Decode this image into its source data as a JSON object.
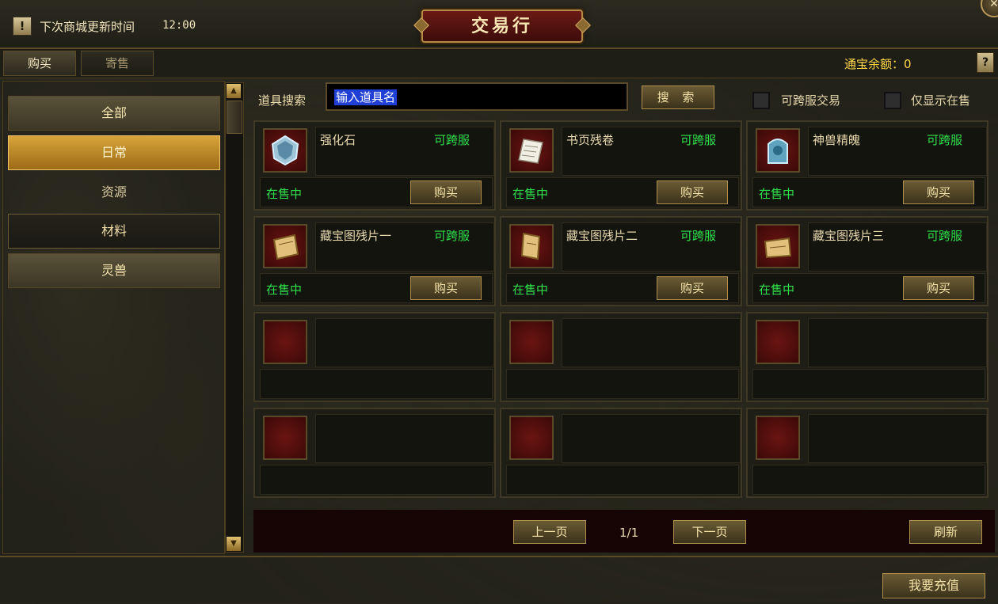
{
  "header": {
    "notice_icon": "!",
    "notice_label": "下次商城更新时间",
    "notice_time": "12:00",
    "title": "交易行",
    "close_icon": "✕"
  },
  "tabs": [
    {
      "label": "购买",
      "active": true
    },
    {
      "label": "寄售",
      "active": false
    }
  ],
  "balance": "通宝余额：0",
  "help_icon": "?",
  "categories": [
    {
      "label": "全部",
      "state": "normal"
    },
    {
      "label": "日常",
      "state": "selected"
    },
    {
      "label": "资源",
      "state": "flat"
    },
    {
      "label": "材料",
      "state": "dark"
    },
    {
      "label": "灵兽",
      "state": "normal"
    }
  ],
  "search": {
    "label": "道具搜索",
    "placeholder": "输入道具名",
    "button": "搜 索"
  },
  "filters": [
    {
      "label": "可跨服交易",
      "checked": false
    },
    {
      "label": "仅显示在售",
      "checked": false
    }
  ],
  "items": [
    {
      "name": "强化石",
      "tag": "可跨服",
      "status": "在售中",
      "buy": "购买",
      "icon": "crystal-stone-icon"
    },
    {
      "name": "书页残卷",
      "tag": "可跨服",
      "status": "在售中",
      "buy": "购买",
      "icon": "paper-scroll-icon"
    },
    {
      "name": "神兽精魄",
      "tag": "可跨服",
      "status": "在售中",
      "buy": "购买",
      "icon": "beast-soul-icon"
    },
    {
      "name": "藏宝图残片一",
      "tag": "可跨服",
      "status": "在售中",
      "buy": "购买",
      "icon": "treasure-map-icon"
    },
    {
      "name": "藏宝图残片二",
      "tag": "可跨服",
      "status": "在售中",
      "buy": "购买",
      "icon": "treasure-map-icon"
    },
    {
      "name": "藏宝图残片三",
      "tag": "可跨服",
      "status": "在售中",
      "buy": "购买",
      "icon": "treasure-map-icon"
    }
  ],
  "empty_slot_count": 6,
  "pager": {
    "prev": "上一页",
    "page": "1/1",
    "next": "下一页",
    "refresh": "刷新"
  },
  "recharge": "我要充值",
  "colors": {
    "accent_gold": "#d7a43b",
    "status_green": "#2ee04a",
    "balance_yellow": "#ffd84a",
    "slot_red": "#6a1512"
  }
}
